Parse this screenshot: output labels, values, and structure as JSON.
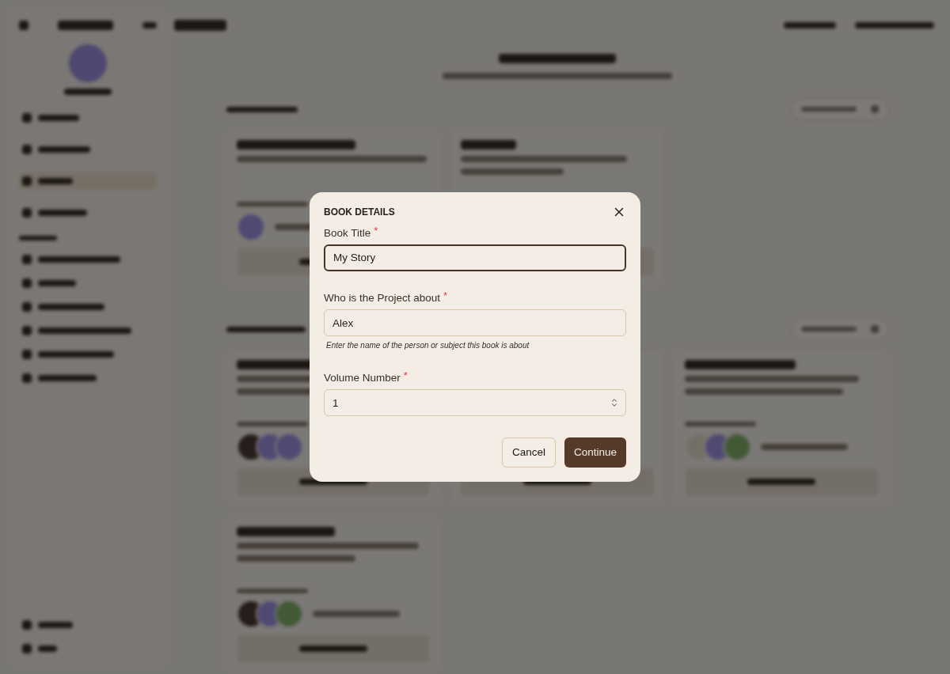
{
  "dialog": {
    "title": "BOOK DETAILS",
    "fields": [
      {
        "kind": "text",
        "label": "Book Title",
        "required_mark": "*",
        "value": "My Story",
        "focused": true
      },
      {
        "kind": "text",
        "label": "Who is the Project about",
        "required_mark": "*",
        "value": "Alex",
        "focused": false,
        "hint": "Enter the name of the person or subject this book is about"
      },
      {
        "kind": "number",
        "label": "Volume Number",
        "required_mark": "*",
        "value": "1",
        "focused": false
      }
    ],
    "buttons": [
      {
        "kind": "secondary",
        "label": "Cancel"
      },
      {
        "kind": "primary",
        "label": "Continue"
      }
    ]
  }
}
